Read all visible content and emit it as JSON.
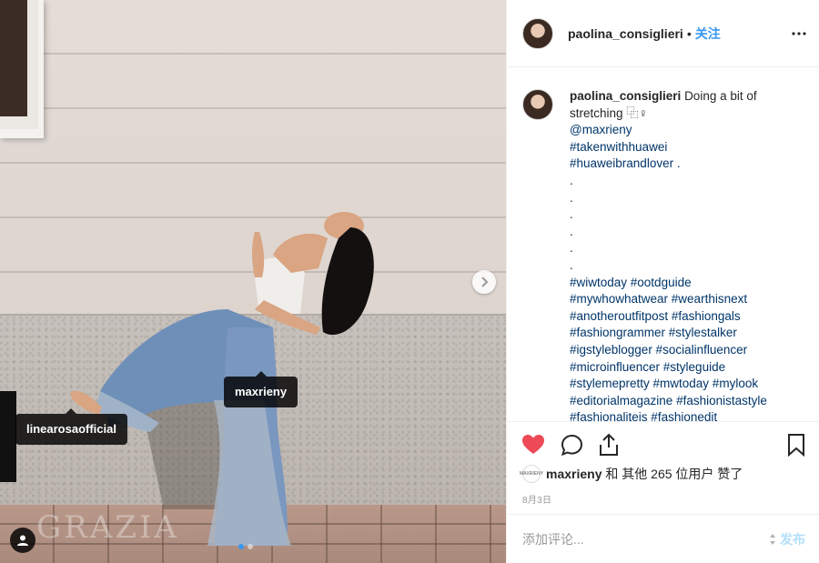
{
  "post": {
    "tags": [
      {
        "label": "maxrieny"
      },
      {
        "label": "linearosaofficial"
      }
    ],
    "watermark": "GRAZIA",
    "carousel": {
      "count": 2,
      "active_index": 0
    }
  },
  "header": {
    "username": "paolina_consiglieri",
    "separator": "•",
    "follow_label": "关注",
    "more_icon": "more-horizontal-icon"
  },
  "caption": {
    "username": "paolina_consiglieri",
    "text_intro": "Doing a bit of stretching",
    "emoji": "⿻♀",
    "mention": "@maxrieny",
    "tags_top": [
      "#takenwithhuawei",
      "#huaweibrandlover ."
    ],
    "dots": [
      ".",
      ".",
      ".",
      ".",
      ".",
      "."
    ],
    "hashtag_lines": [
      "#wiwtoday #ootdguide",
      "#mywhowhatwear #wearthisnext",
      "#anotheroutfitpost #fashiongals",
      "#fashiongrammer #stylestalker",
      "#igstyleblogger #socialinfluencer",
      "#microinfluencer #styleguide",
      "#stylemepretty #mwtoday #mylook",
      "#editorialmagazine #fashionistastyle",
      "#fashionaliteis #fashionedit"
    ]
  },
  "actions": {
    "like_icon": "heart-filled-icon",
    "comment_icon": "comment-icon",
    "share_icon": "share-icon",
    "save_icon": "bookmark-icon",
    "like_color": "#ed4956"
  },
  "likes": {
    "avatar_text": "MAXRIENY",
    "liker": "maxrieny",
    "middle": "和 其他 265 位用户",
    "suffix": "赞了"
  },
  "date": "8月3日",
  "comment": {
    "placeholder": "添加评论...",
    "post_label": "发布"
  },
  "colors": {
    "accent": "#3897f0",
    "text": "#262626",
    "muted": "#999999",
    "link": "#003569"
  }
}
